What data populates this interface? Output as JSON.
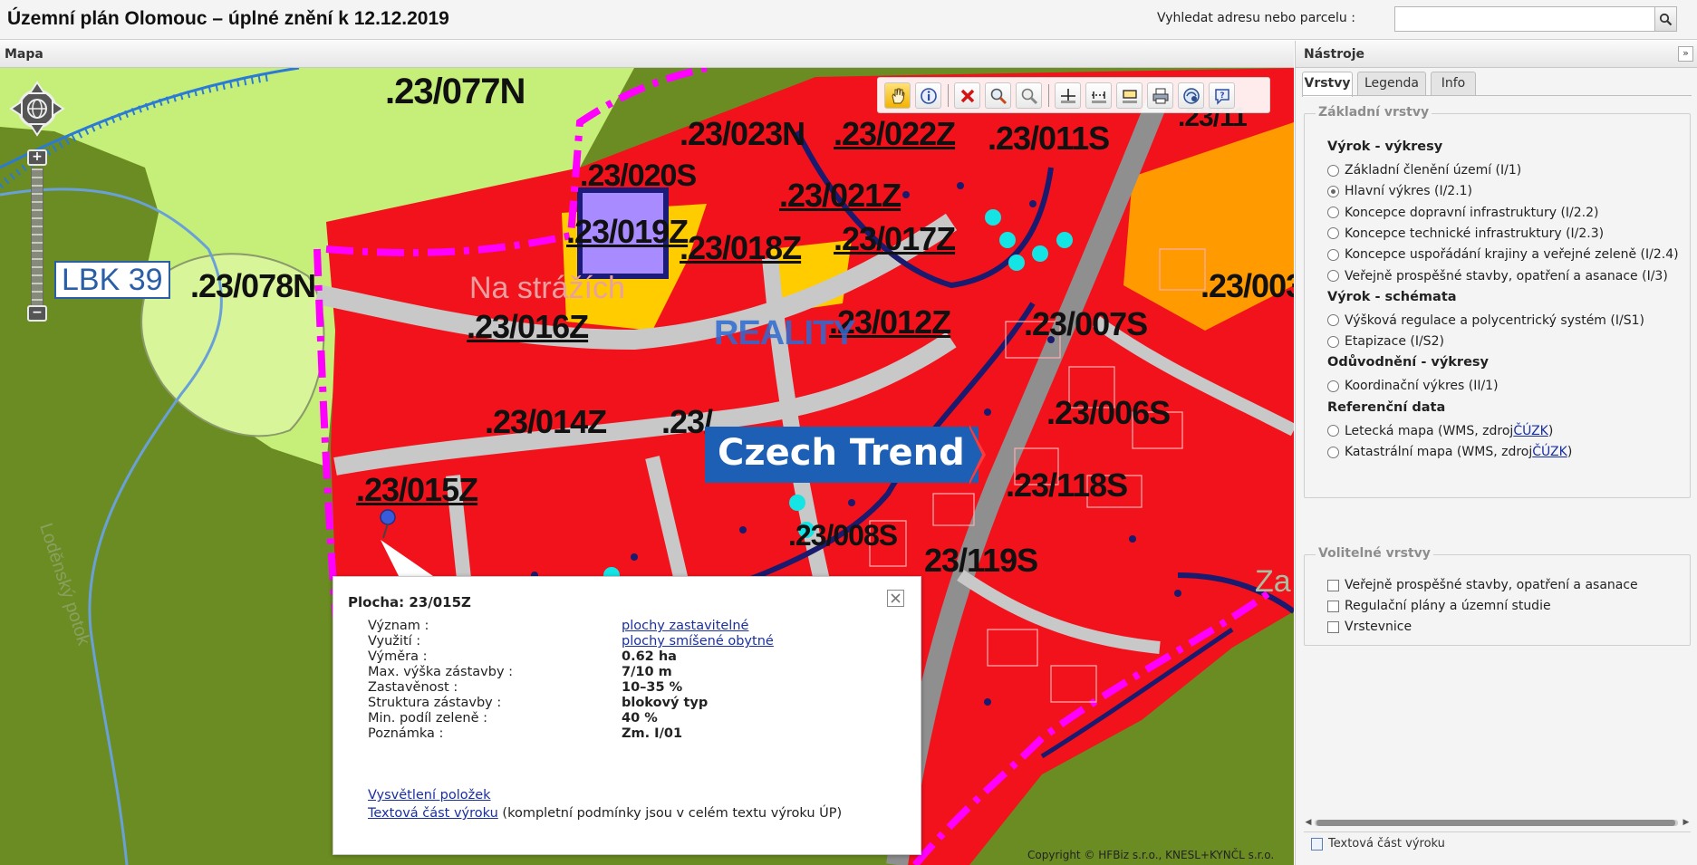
{
  "app": {
    "title": "Územní plán Olomouc – úplné znění k 12.12.2019",
    "search_label": "Vyhledat adresu nebo parcelu :",
    "search_placeholder": "",
    "search_value": ""
  },
  "map": {
    "panel_title": "Mapa",
    "labels": {
      "p077n": ".23/077N",
      "p078n": ".23/078N",
      "p023n": ".23/023N",
      "p020s": ".23/020S",
      "p019z": ".23/019Z",
      "p018z": ".23/018Z",
      "p022z": ".23/022Z",
      "p021z": ".23/021Z",
      "p011s": ".23/011S",
      "p017z": ".23/017Z",
      "p016z": ".23/016Z",
      "p012z": ".23/012Z",
      "p007s": ".23/007S",
      "p003": ".23/003",
      "p014z": ".23/014Z",
      "p013": ".23/",
      "p006s": ".23/006S",
      "p015z": ".23/015Z",
      "p118s": ".23/118S",
      "p119s": "23/119S",
      "p008": ".23/008S",
      "p11x": ".23/11",
      "street": "Na strážích",
      "lbk": "LBK 39",
      "za": "Za",
      "river": "Loděnský potok"
    },
    "watermark": {
      "top": "REALITY",
      "bottom": "Czech Trend"
    },
    "copyright": "Copyright © HFBiz s.r.o., KNESL+KYNČL s.r.o."
  },
  "toolbar": {
    "items": [
      {
        "name": "pan-hand-icon"
      },
      {
        "name": "info-icon"
      },
      {
        "name": "clear-cross-icon"
      },
      {
        "name": "zoom-in-icon"
      },
      {
        "name": "zoom-out-icon"
      },
      {
        "name": "measure-point-icon"
      },
      {
        "name": "measure-line-icon"
      },
      {
        "name": "measure-area-icon"
      },
      {
        "name": "print-icon"
      },
      {
        "name": "layers-globe-icon"
      },
      {
        "name": "help-icon"
      }
    ]
  },
  "popup": {
    "title": "Plocha: 23/015Z",
    "rows": [
      {
        "label": "Význam :",
        "value": "plochy zastavitelné",
        "link": true
      },
      {
        "label": "Využití :",
        "value": "plochy smíšené obytné",
        "link": true
      },
      {
        "label": "Výměra :",
        "value": "0.62 ha",
        "link": false
      },
      {
        "label": "Max. výška zástavby :",
        "value": "7/10 m",
        "link": false
      },
      {
        "label": "Zastavěnost :",
        "value": "10–35 %",
        "link": false
      },
      {
        "label": "Struktura zástavby :",
        "value": "blokový typ",
        "link": false
      },
      {
        "label": "Min. podíl zeleně :",
        "value": "40 %",
        "link": false
      },
      {
        "label": "Poznámka :",
        "value": "Zm. I/01",
        "link": false
      }
    ],
    "explain_link": "Vysvětlení položek",
    "text_link": "Textová část výroku",
    "text_note": " (kompletní podmínky jsou v celém textu výroku ÚP)"
  },
  "tools": {
    "panel_title": "Nástroje",
    "collapse_label": "»",
    "tabs": [
      "Vrstvy",
      "Legenda",
      "Info"
    ],
    "active_tab": "Vrstvy",
    "basic_layers": {
      "legend": "Základní vrstvy",
      "groups": [
        {
          "title": "Výrok - výkresy",
          "options": [
            {
              "label": "Základní členění území (I/1)",
              "checked": false
            },
            {
              "label": "Hlavní výkres (I/2.1)",
              "checked": true
            },
            {
              "label": "Koncepce dopravní infrastruktury (I/2.2)",
              "checked": false
            },
            {
              "label": "Koncepce technické infrastruktury (I/2.3)",
              "checked": false
            },
            {
              "label": "Koncepce uspořádání krajiny a veřejné zeleně (I/2.4)",
              "checked": false
            },
            {
              "label": "Veřejně prospěšné stavby, opatření a asanace (I/3)",
              "checked": false
            }
          ]
        },
        {
          "title": "Výrok - schémata",
          "options": [
            {
              "label": "Výšková regulace a polycentrický systém (I/S1)",
              "checked": false
            },
            {
              "label": "Etapizace (I/S2)",
              "checked": false
            }
          ]
        },
        {
          "title": "Odůvodnění - výkresy",
          "options": [
            {
              "label": "Koordinační výkres (II/1)",
              "checked": false
            }
          ]
        },
        {
          "title": "Referenční data",
          "options": [
            {
              "label": "Letecká mapa (WMS, zdroj ",
              "link": "ČÚZK",
              "suffix": ")",
              "checked": false
            },
            {
              "label": "Katastrální mapa (WMS, zdroj ",
              "link": "ČÚZK",
              "suffix": ")",
              "checked": false
            }
          ]
        }
      ]
    },
    "optional_layers": {
      "legend": "Volitelné vrstvy",
      "options": [
        {
          "label": "Veřejně prospěšné stavby, opatření a asanace",
          "checked": false
        },
        {
          "label": "Regulační plány a územní studie",
          "checked": false
        },
        {
          "label": "Vrstevnice",
          "checked": false
        }
      ]
    },
    "footer_label": "Textová část výroku"
  }
}
